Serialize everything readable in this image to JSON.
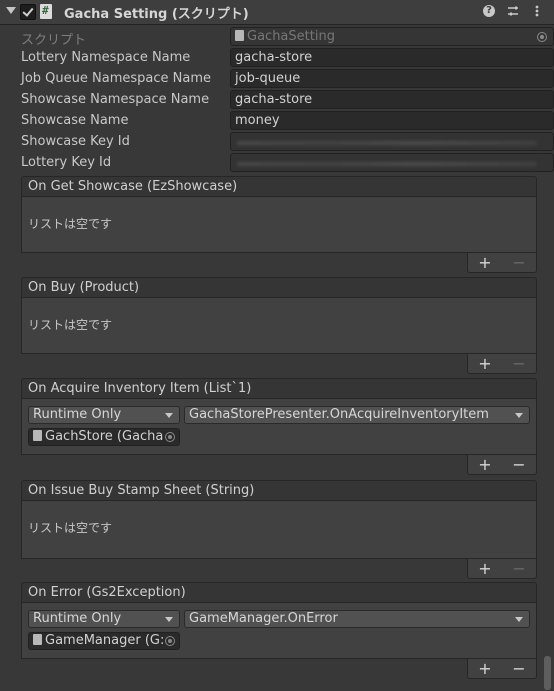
{
  "header": {
    "title": "Gacha Setting (スクリプト)",
    "icons": [
      "help-icon",
      "preset-icon",
      "menu-icon"
    ]
  },
  "properties": {
    "script": {
      "label": "スクリプト",
      "value": "GachaSetting"
    },
    "lottery_ns": {
      "label": "Lottery Namespace Name",
      "value": "gacha-store"
    },
    "jobqueue_ns": {
      "label": "Job Queue Namespace Name",
      "value": "job-queue"
    },
    "showcase_ns": {
      "label": "Showcase Namespace Name",
      "value": "gacha-store"
    },
    "showcase_name": {
      "label": "Showcase Name",
      "value": "money"
    },
    "showcase_key": {
      "label": "Showcase Key Id"
    },
    "lottery_key": {
      "label": "Lottery Key Id"
    }
  },
  "events": {
    "get_showcase": {
      "title": "On Get Showcase (EzShowcase)",
      "empty": "リストは空です"
    },
    "buy": {
      "title": "On Buy (Product)",
      "empty": "リストは空です"
    },
    "acquire": {
      "title": "On Acquire Inventory Item (List`1)",
      "runtime": "Runtime Only",
      "method": "GachaStorePresenter.OnAcquireInventoryItem",
      "object": "GachStore (Gacha"
    },
    "issue": {
      "title": "On Issue Buy Stamp Sheet (String)",
      "empty": "リストは空です"
    },
    "error": {
      "title": "On Error (Gs2Exception)",
      "runtime": "Runtime Only",
      "method": "GameManager.OnError",
      "object": "GameManager (G:"
    }
  },
  "footer": {
    "plus": "+",
    "minus": "−"
  }
}
